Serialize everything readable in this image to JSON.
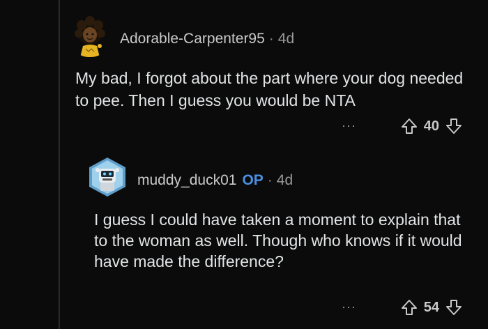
{
  "comments": [
    {
      "author": "Adorable-Carpenter95",
      "separator": "·",
      "time": "4d",
      "body": "My bad, I forgot about the part where your dog needed to pee. Then I guess you would be NTA",
      "more_label": "···",
      "votes": "40",
      "avatar_icon": "avatar-girl-icon",
      "op_badge": ""
    },
    {
      "author": "muddy_duck01",
      "separator": "·",
      "time": "4d",
      "body": "I guess I could have taken a moment to explain that to the woman as well. Though who knows if it would have made the difference?",
      "more_label": "···",
      "votes": "54",
      "avatar_icon": "avatar-robot-icon",
      "op_badge": "OP"
    }
  ],
  "colors": {
    "background": "#0b0b0b",
    "text": "#e2e4e6",
    "muted": "#9a9a9a",
    "op_blue": "#4a90e2"
  }
}
